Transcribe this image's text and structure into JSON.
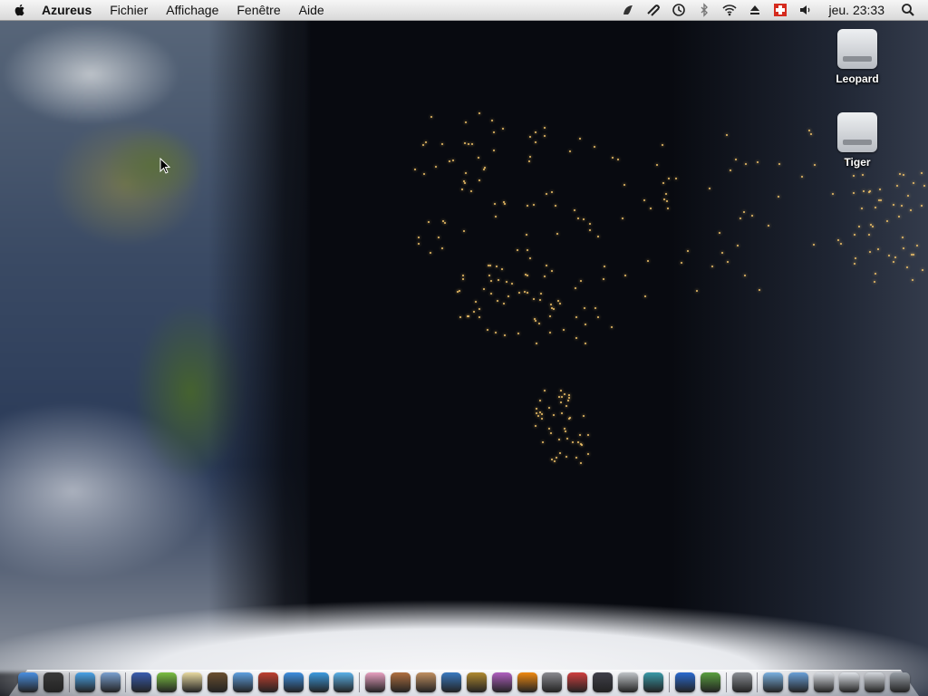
{
  "menubar": {
    "app_name": "Azureus",
    "menus": [
      "Fichier",
      "Affichage",
      "Fenêtre",
      "Aide"
    ],
    "clock": "jeu. 23:33",
    "status_icons": [
      "growl-icon",
      "script-icon",
      "time-machine-icon",
      "bluetooth-icon",
      "wifi-icon",
      "eject-icon",
      "swiss-flag-icon",
      "volume-icon",
      "spotlight-icon"
    ]
  },
  "desktop": {
    "volumes": [
      {
        "label": "Leopard",
        "icon": "hard-drive-icon"
      },
      {
        "label": "Tiger",
        "icon": "hard-drive-icon"
      }
    ]
  },
  "dock": {
    "groups": [
      [
        {
          "name": "finder",
          "color": "#4a8fe0"
        },
        {
          "name": "dashboard",
          "color": "#3a3a3a"
        }
      ],
      [
        {
          "name": "safari",
          "color": "#4aa3e8"
        },
        {
          "name": "preview",
          "color": "#7aa0d0"
        }
      ],
      [
        {
          "name": "automator",
          "color": "#3a5db0"
        },
        {
          "name": "app-green",
          "color": "#7bc043"
        },
        {
          "name": "app-box",
          "color": "#e8d9a0"
        },
        {
          "name": "app-dvd",
          "color": "#6b5030"
        },
        {
          "name": "app-blue",
          "color": "#5fa0e0"
        },
        {
          "name": "app-chess",
          "color": "#c04030"
        },
        {
          "name": "itunes",
          "color": "#3e8fe0"
        },
        {
          "name": "ichat",
          "color": "#3c9be0"
        },
        {
          "name": "messenger",
          "color": "#5ab0e8"
        }
      ],
      [
        {
          "name": "app-pink",
          "color": "#e8a0c0"
        },
        {
          "name": "photo",
          "color": "#b07040"
        },
        {
          "name": "app-disc",
          "color": "#c09060"
        },
        {
          "name": "imovie",
          "color": "#3a7ac0"
        },
        {
          "name": "app-pineapple",
          "color": "#b08a30"
        },
        {
          "name": "app-ribbon",
          "color": "#b060c0"
        },
        {
          "name": "vlc",
          "color": "#f08a10"
        },
        {
          "name": "camera",
          "color": "#8a8a90"
        },
        {
          "name": "keychain",
          "color": "#d04040"
        },
        {
          "name": "app-x",
          "color": "#40404a"
        },
        {
          "name": "app-usb",
          "color": "#c0c4c8"
        },
        {
          "name": "app-dial",
          "color": "#3a9aa8"
        }
      ],
      [
        {
          "name": "word",
          "color": "#2a6ad0"
        },
        {
          "name": "app-vine",
          "color": "#5aa040"
        }
      ],
      [
        {
          "name": "system-prefs",
          "color": "#8a8e94"
        }
      ],
      [
        {
          "name": "folder-1",
          "color": "#7ab0e0"
        },
        {
          "name": "folder-2",
          "color": "#6aa0d8"
        },
        {
          "name": "stack-1",
          "color": "#d8dce2"
        },
        {
          "name": "stack-2",
          "color": "#e0e4ea"
        },
        {
          "name": "stack-3",
          "color": "#d4d8de"
        },
        {
          "name": "trash",
          "color": "#9aa0a8"
        }
      ]
    ]
  }
}
